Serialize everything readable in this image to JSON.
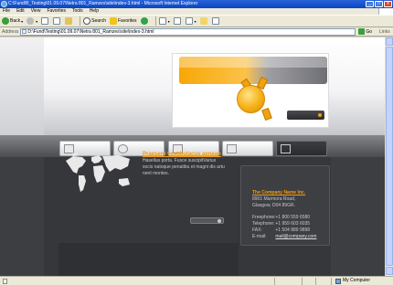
{
  "window": {
    "title": "C:\\Fund\\B_Testing\\01.09.07\\Netra 801_Ramzes\\site\\index-3.html - Microsoft Internet Explorer",
    "min_label": "_",
    "max_label": "□",
    "close_label": "x"
  },
  "menu": {
    "items": [
      "File",
      "Edit",
      "View",
      "Favorites",
      "Tools",
      "Help"
    ]
  },
  "toolbar": {
    "back_label": "Back",
    "search_label": "Search",
    "favorites_label": "Favorites"
  },
  "address": {
    "label": "Address",
    "value": "D:\\Fund\\Testing\\01.09.07\\Netra 801_Ramzes\\site\\index-3.html",
    "go_label": "Go",
    "links_label": "Links"
  },
  "page": {
    "promo": {
      "title": "Praesent vestibulacus aenean",
      "text": "Hasellus porta. Fusce suscipitVarius socis natoque penatibu et magni dis artu nent montes."
    },
    "contact": {
      "title": "The Company Name Inc.",
      "address_line1": "8901 Marmora Road,",
      "address_line2": "Glasgow, D04 89GR.",
      "freephone_label": "Freephone:",
      "freephone_value": "+1 800 559 6580",
      "telephone_label": "Telephone:",
      "telephone_value": "+1 959 603 6035",
      "fax_label": "FAX:",
      "fax_value": "+1 504 889 9898",
      "email_label": "E-mail:",
      "email_value": "mail@company.com"
    }
  },
  "status": {
    "zone_label": "My Computer"
  },
  "colors": {
    "accent": "#f39c0c",
    "page_bg": "#3d3e42",
    "xp_title": "#0a46c2"
  }
}
